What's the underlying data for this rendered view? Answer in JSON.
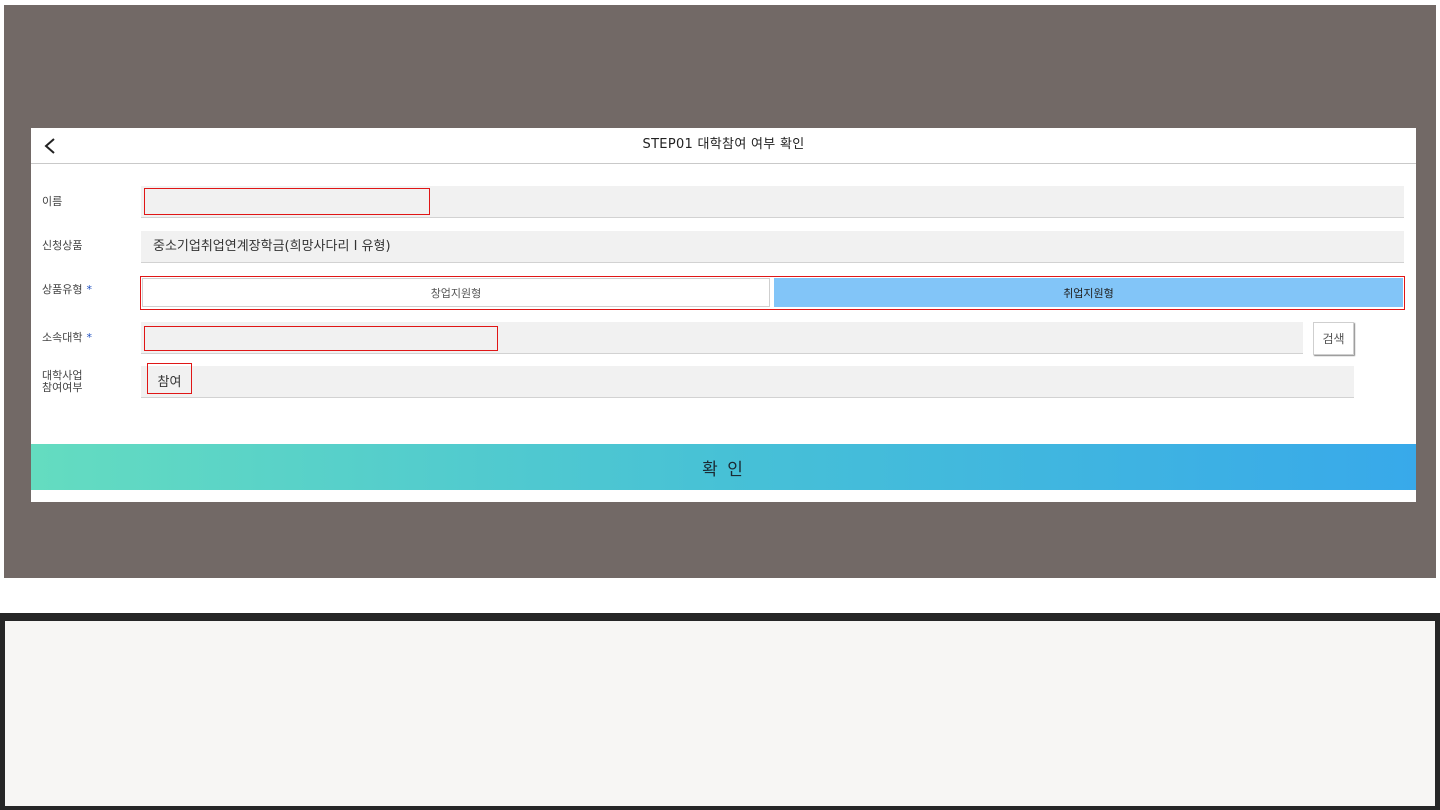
{
  "modal": {
    "title": "STEP01 대학참여 여부 확인",
    "back_icon": "chevron-left-icon"
  },
  "form": {
    "name": {
      "label": "이름",
      "value": ""
    },
    "product": {
      "label": "신청상품",
      "value": "중소기업취업연계장학금(희망사다리 I 유형)"
    },
    "product_type": {
      "label": "상품유형",
      "required_mark": "*",
      "options": [
        "창업지원형",
        "취업지원형"
      ],
      "selected": "취업지원형"
    },
    "university": {
      "label": "소속대학",
      "required_mark": "*",
      "value": "",
      "search_label": "검색"
    },
    "participation": {
      "label_line1": "대학사업",
      "label_line2": "참여여부",
      "value": "참여"
    }
  },
  "confirm_label": "확 인",
  "colors": {
    "overlay": "#726966",
    "selected_toggle": "#82c5f8",
    "highlight_border": "#e01616",
    "confirm_gradient_start": "#64dcc0",
    "confirm_gradient_end": "#38a9ea"
  }
}
